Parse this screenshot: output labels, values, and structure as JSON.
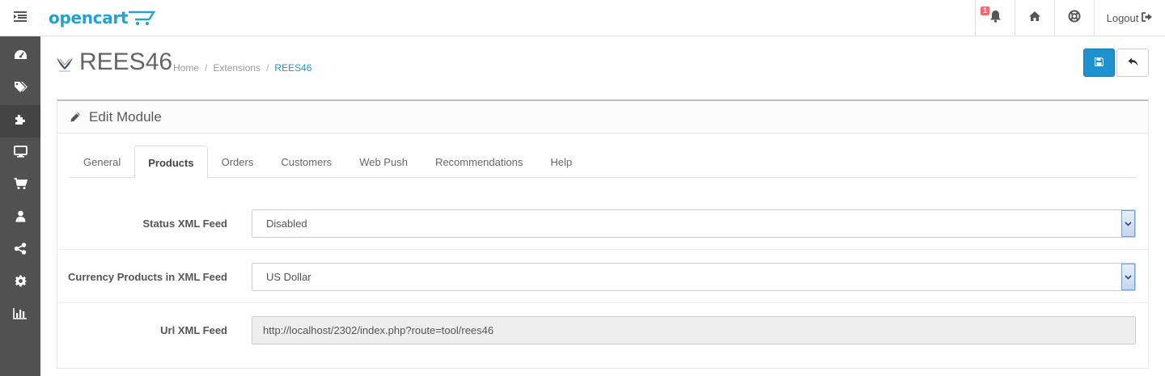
{
  "header": {
    "brand": "opencart",
    "notification_count": "1",
    "logout_label": "Logout"
  },
  "sidebar": {
    "items": [
      {
        "icon": "dashboard-icon"
      },
      {
        "icon": "tags-icon"
      },
      {
        "icon": "puzzle-icon",
        "active": true
      },
      {
        "icon": "desktop-icon"
      },
      {
        "icon": "shopping-cart-icon"
      },
      {
        "icon": "user-icon"
      },
      {
        "icon": "share-icon"
      },
      {
        "icon": "cog-icon"
      },
      {
        "icon": "bar-chart-icon"
      }
    ]
  },
  "page": {
    "title": "REES46",
    "breadcrumb": [
      "Home",
      "Extensions",
      "REES46"
    ]
  },
  "panel": {
    "heading": "Edit Module"
  },
  "tabs": [
    "General",
    "Products",
    "Orders",
    "Customers",
    "Web Push",
    "Recommendations",
    "Help"
  ],
  "active_tab": "Products",
  "form": {
    "status_label": "Status XML Feed",
    "status_value": "Disabled",
    "currency_label": "Currency Products in XML Feed",
    "currency_value": "US Dollar",
    "url_label": "Url XML Feed",
    "url_value": "http://localhost/2302/index.php?route=tool/rees46"
  },
  "colors": {
    "accent": "#1e91cf",
    "brand": "#23a1d1",
    "sidebar_bg": "#515151",
    "badge": "#f56b6b"
  }
}
